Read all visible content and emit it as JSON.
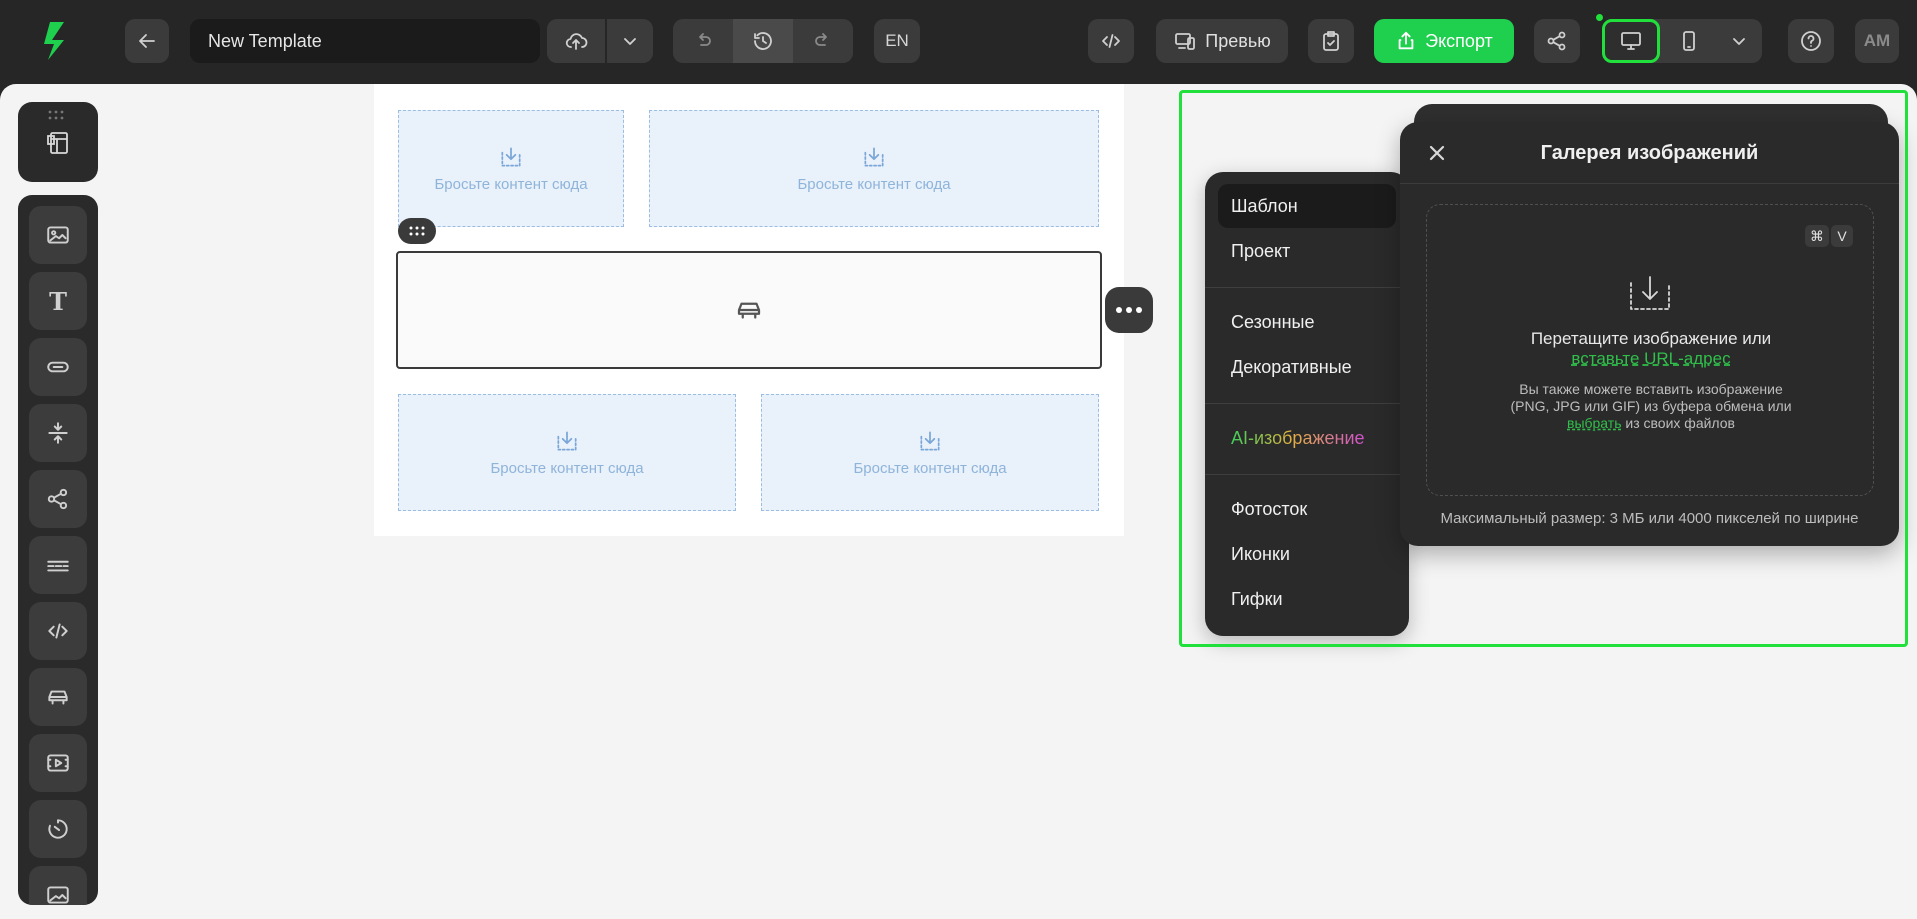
{
  "header": {
    "template_name": "New Template",
    "language": "EN",
    "preview_label": "Превью",
    "export_label": "Экспорт",
    "avatar_initials": "AM",
    "brand_color": "#1fcf4e"
  },
  "canvas": {
    "dropzone_text": "Бросьте контент сюда"
  },
  "category_menu": {
    "items": [
      {
        "label": "Шаблон"
      },
      {
        "label": "Проект"
      },
      {
        "label": "Сезонные"
      },
      {
        "label": "Декоративные"
      },
      {
        "label": "AI-изображение"
      },
      {
        "label": "Фотосток"
      },
      {
        "label": "Иконки"
      },
      {
        "label": "Гифки"
      }
    ],
    "active": "Шаблон"
  },
  "gallery": {
    "title": "Галерея изображений",
    "shortcut_cmd": "⌘",
    "shortcut_key": "V",
    "drag_text": "Перетащите изображение или",
    "url_link": "вставьте URL-адрес",
    "sub_text_1": "Вы также можете вставить изображение",
    "sub_text_2": "(PNG, JPG или GIF) из буфера обмена или",
    "choose_link": "выбрать",
    "sub_text_3": "из своих файлов",
    "max_size": "Максимальный размер: 3 МБ или 4000 пикселей по ширине"
  }
}
